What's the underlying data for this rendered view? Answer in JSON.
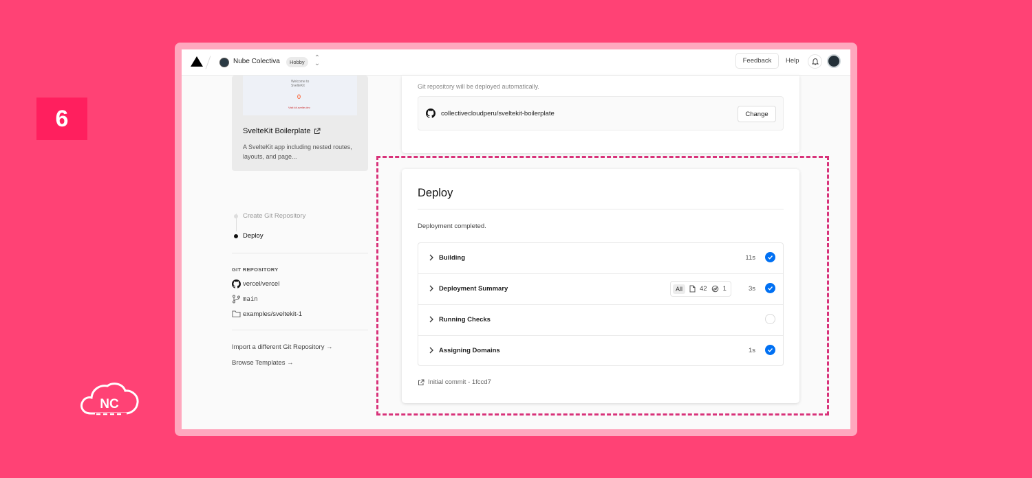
{
  "step_badge": "6",
  "brand_logo": {
    "text": "NC",
    "icon": "cloud-icon"
  },
  "topbar": {
    "team_name": "Nube Colectiva",
    "plan_badge": "Hobby",
    "feedback_label": "Feedback",
    "help_label": "Help"
  },
  "template_card": {
    "preview": {
      "line1": "Welcome to",
      "line2": "SvelteKit",
      "count": "0",
      "footer": "Visit kit.svelte.dev"
    },
    "title": "SvelteKit Boilerplate",
    "description": "A SvelteKit app including nested routes, layouts, and page..."
  },
  "steps": [
    {
      "label": "Create Git Repository",
      "active": false
    },
    {
      "label": "Deploy",
      "active": true
    }
  ],
  "git_repository": {
    "heading": "GIT REPOSITORY",
    "repo": "vercel/vercel",
    "branch": "main",
    "directory": "examples/sveltekit-1"
  },
  "side_links": {
    "import": "Import a different Git Repository →",
    "browse": "Browse Templates →"
  },
  "git_card": {
    "note": "Git repository will be deployed automatically.",
    "repo_name": "collectivecloudperu/sveltekit-boilerplate",
    "change_label": "Change"
  },
  "deploy": {
    "title": "Deploy",
    "status": "Deployment completed.",
    "steps": [
      {
        "label": "Building",
        "time": "11s",
        "done": true
      },
      {
        "label": "Deployment Summary",
        "time": "3s",
        "done": true,
        "summary": {
          "all_label": "All",
          "files": "42",
          "functions": "1"
        }
      },
      {
        "label": "Running Checks",
        "time": "",
        "done": false
      },
      {
        "label": "Assigning Domains",
        "time": "1s",
        "done": true
      }
    ],
    "commit": "Initial commit - 1fccd7"
  },
  "colors": {
    "background": "#ff4275",
    "accent_blue": "#0070f3",
    "highlight_dash": "#d8327a"
  }
}
